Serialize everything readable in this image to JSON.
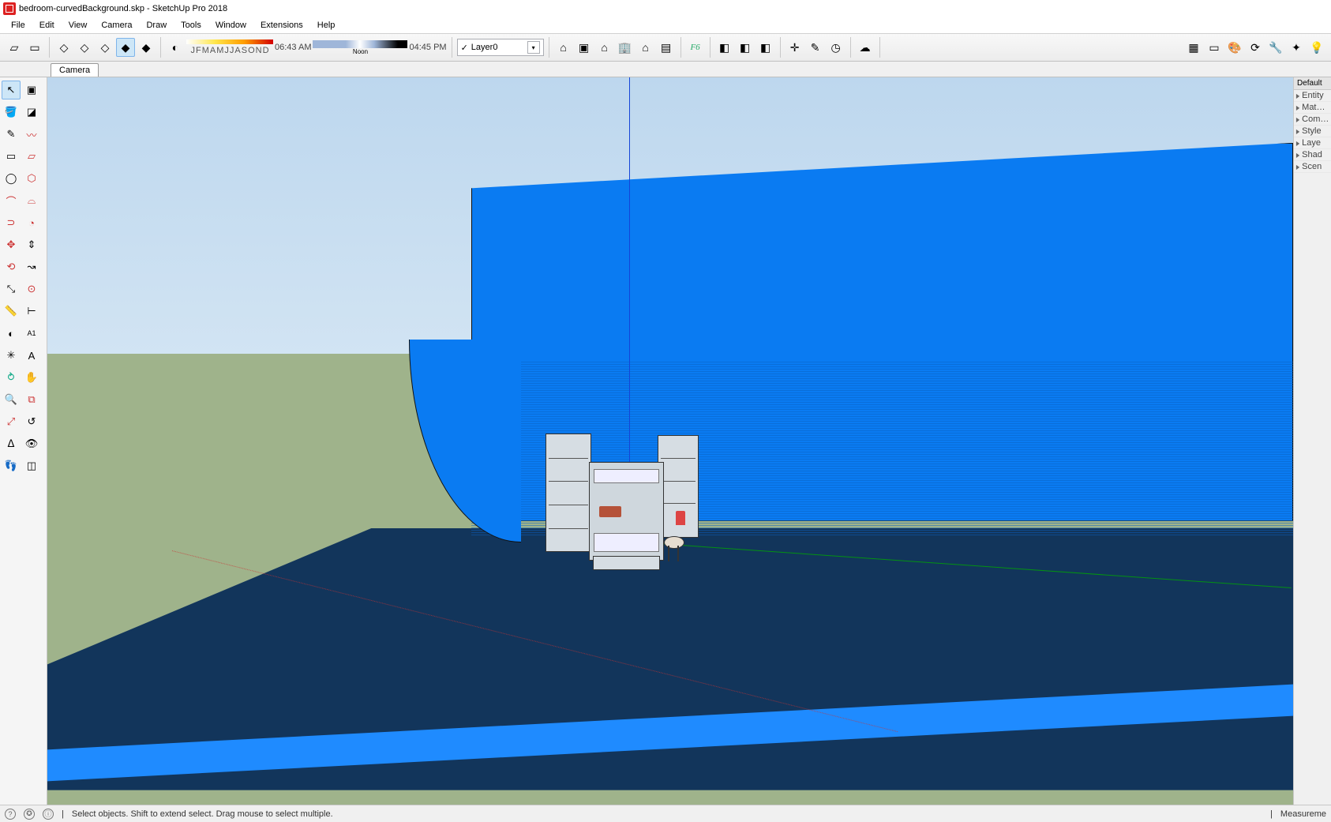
{
  "title": "bedroom-curvedBackground.skp - SketchUp Pro 2018",
  "menu": [
    "File",
    "Edit",
    "View",
    "Camera",
    "Draw",
    "Tools",
    "Window",
    "Extensions",
    "Help"
  ],
  "months": [
    "J",
    "F",
    "M",
    "A",
    "M",
    "J",
    "J",
    "A",
    "S",
    "O",
    "N",
    "D"
  ],
  "sun": {
    "rise": "06:43 AM",
    "noon": "Noon",
    "set": "04:45 PM"
  },
  "layer": {
    "selected": "Layer0"
  },
  "scene_tab": "Camera",
  "tray": {
    "header": "Default",
    "panels": [
      "Entity",
      "Mat…",
      "Com…",
      "Style",
      "Laye",
      "Shad",
      "Scen"
    ]
  },
  "status": {
    "hint": "Select objects. Shift to extend select. Drag mouse to select multiple.",
    "measure_label": "Measureme"
  },
  "top_tools": {
    "group1": [
      "new-model",
      "open-model",
      "save-model",
      "cut",
      "copy",
      "paste",
      "undo",
      "redo"
    ],
    "group2": [
      "paint-bucket"
    ],
    "group3": [
      "model-info",
      "component-options",
      "house",
      "building",
      "house-small",
      "building-alt"
    ],
    "group4": [
      "fredo6-script"
    ],
    "group5": [
      "box-yellow",
      "box-orange",
      "box-green"
    ],
    "group6": [
      "compass",
      "scalpel",
      "clock"
    ],
    "group7": [
      "cloud"
    ],
    "group8": [
      "terrain",
      "screen",
      "palette",
      "rotate-cw",
      "wrench",
      "star",
      "bulb"
    ]
  },
  "left_tools": [
    "select",
    "make-component",
    "paint-bucket",
    "eraser",
    "line",
    "freehand",
    "rectangle",
    "rotated-rect",
    "circle",
    "polygon",
    "arc",
    "two-point-arc",
    "three-point-arc",
    "pie",
    "move",
    "push-pull",
    "rotate",
    "follow-me",
    "scale",
    "offset",
    "tape-measure",
    "dimension",
    "protractor",
    "text",
    "axes",
    "3d-text",
    "orbit",
    "pan",
    "zoom",
    "zoom-window",
    "zoom-extents",
    "previous-view",
    "position-camera",
    "look-around",
    "walk",
    "section-plane"
  ],
  "colors": {
    "accent": "#0a7bf2",
    "floor": "#12355b",
    "ground": "#9fb38b"
  }
}
